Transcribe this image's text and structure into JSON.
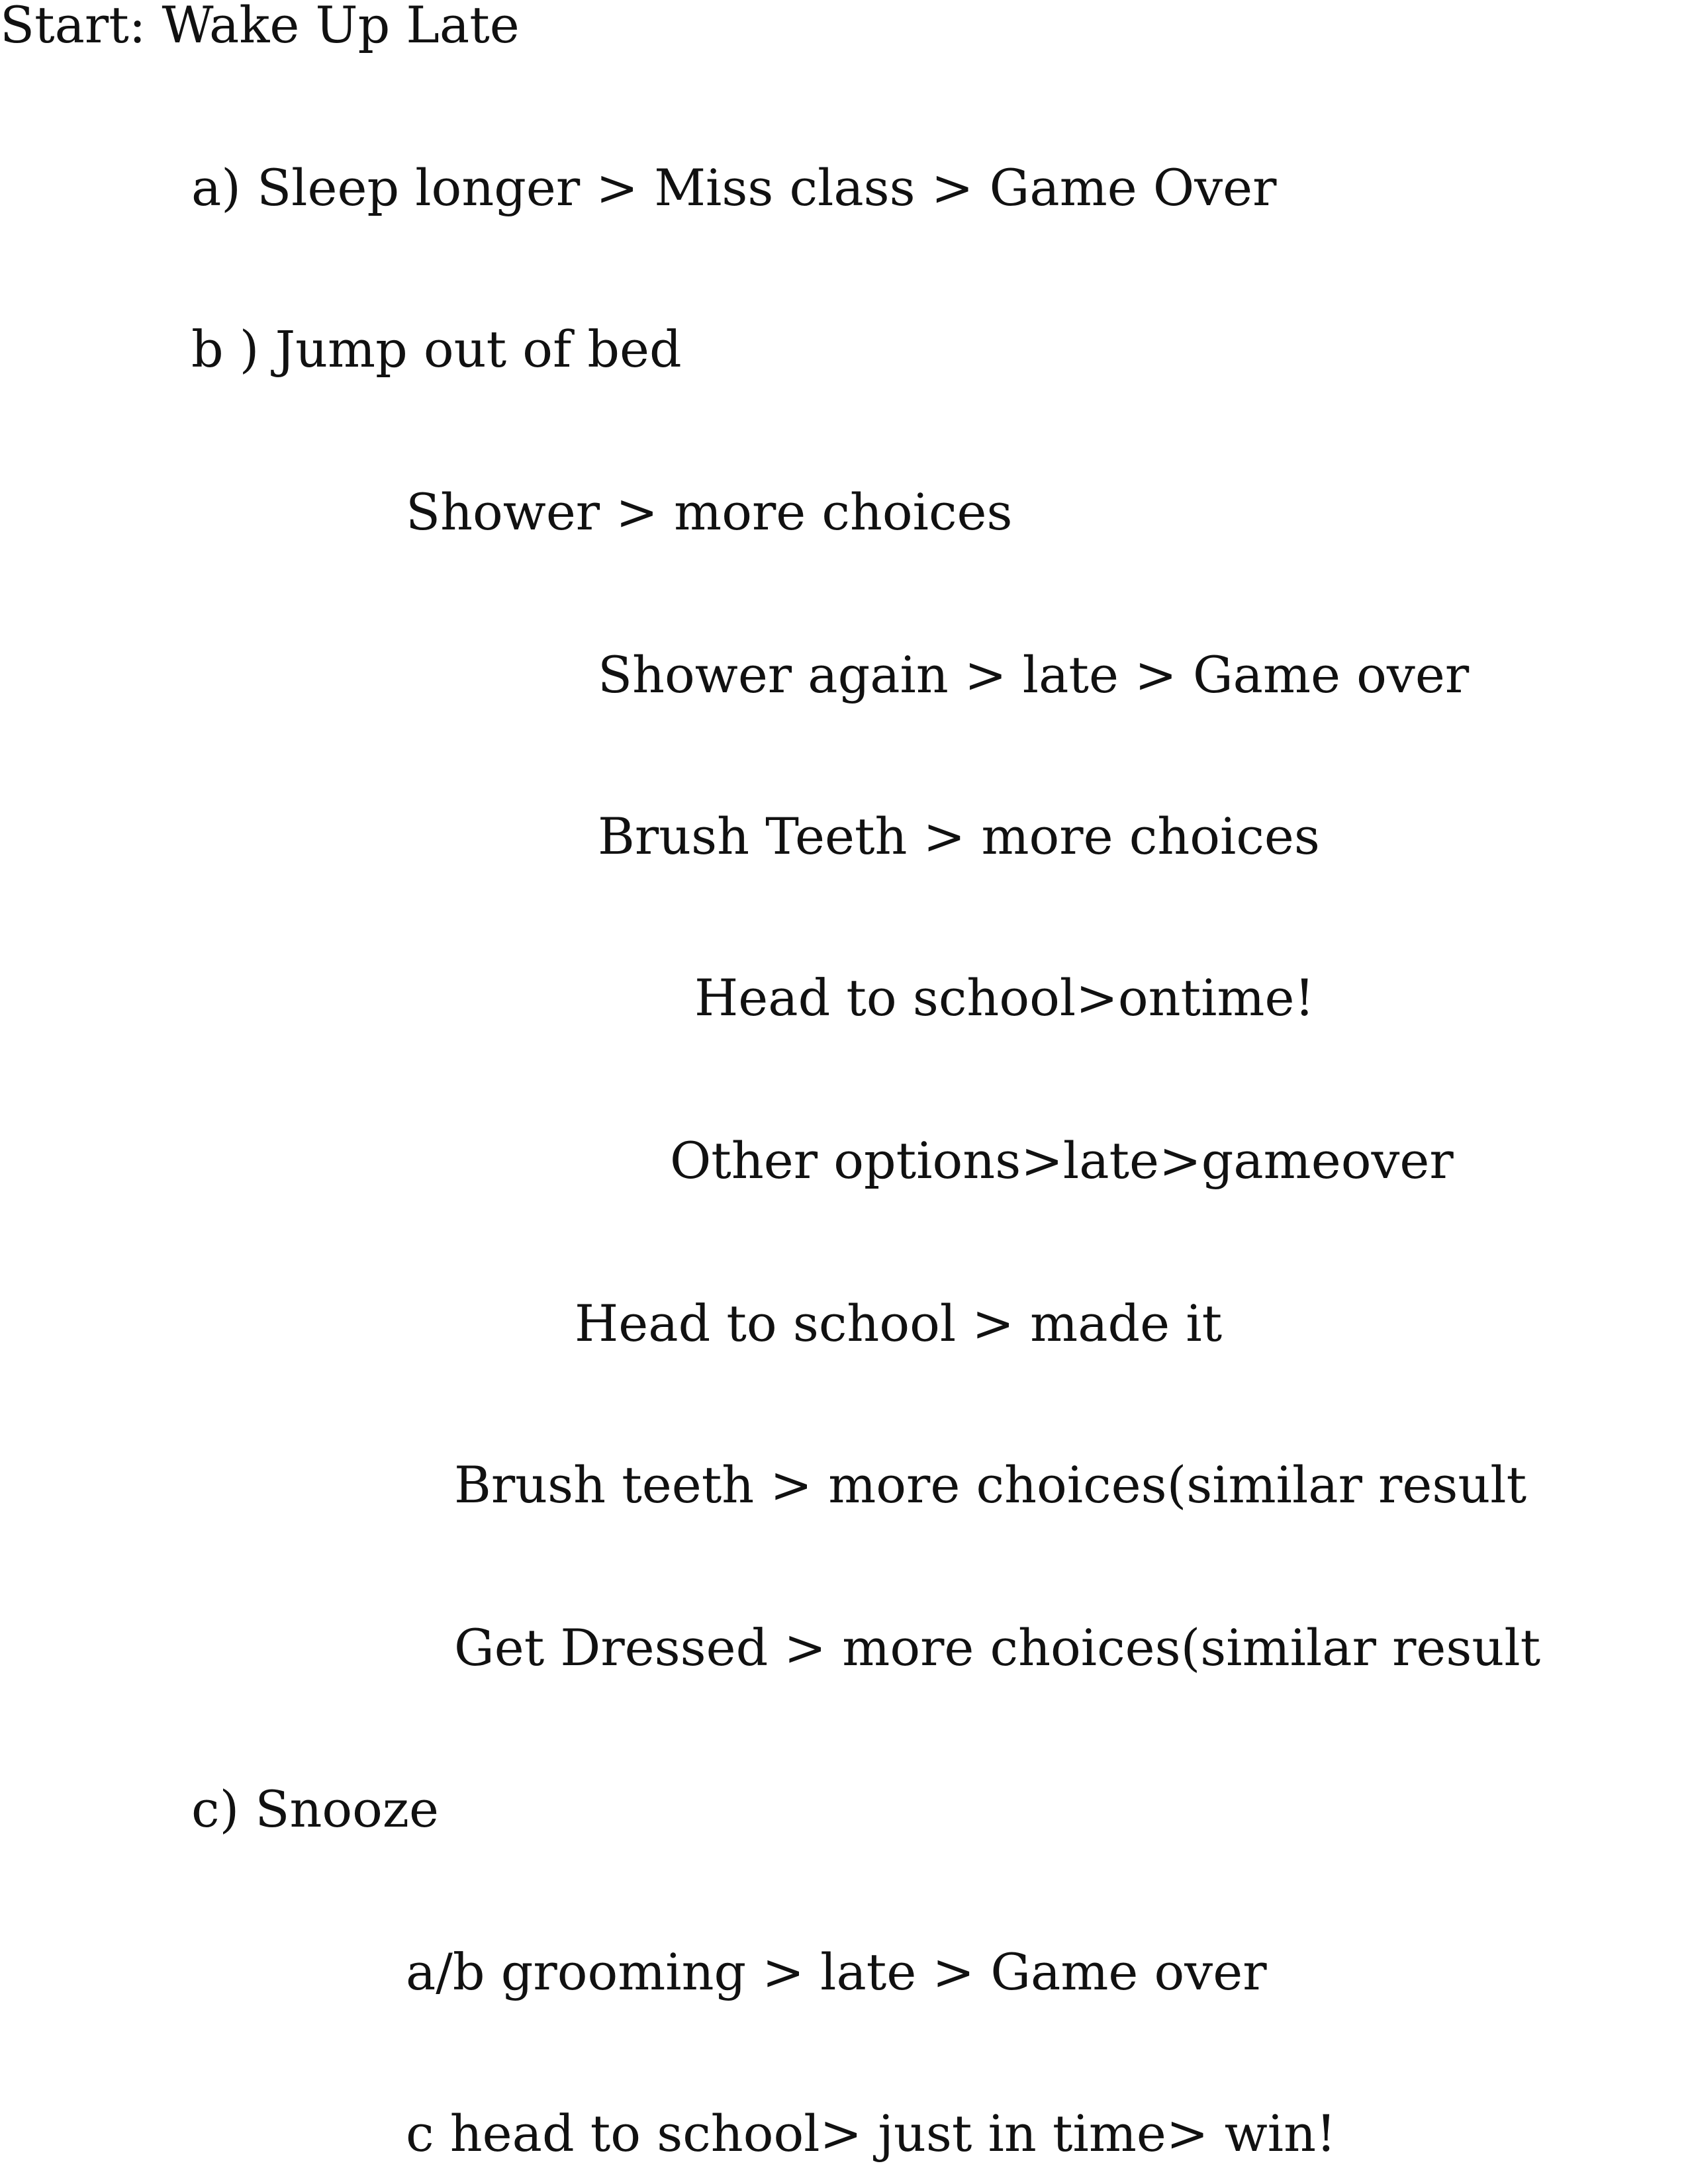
{
  "lines": [
    "Start: Wake Up Late",
    "a) Sleep longer > Miss class > Game Over",
    "b ) Jump out of bed",
    "Shower > more choices",
    "Shower again > late > Game over",
    "Brush Teeth > more choices",
    "Head to school>ontime!",
    "Other options>late>gameover",
    "Head to school > made it",
    "Brush teeth > more choices(similar result",
    "Get Dressed > more choices(similar result",
    "c) Snooze",
    "a/b grooming > late > Game over",
    "c head to school> just in time> win!"
  ]
}
